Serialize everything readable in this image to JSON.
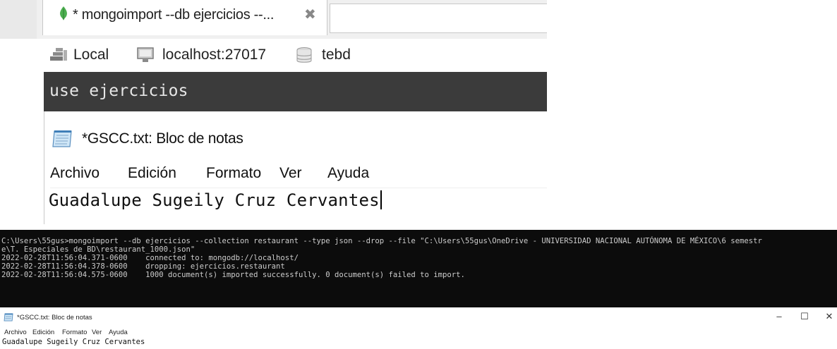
{
  "mongo_gui": {
    "tab": {
      "label": "* mongoimport --db ejercicios --...",
      "close_glyph": "✖"
    },
    "breadcrumb": {
      "local": "Local",
      "host": "localhost:27017",
      "db": "tebd"
    },
    "shell_command": "use ejercicios"
  },
  "notepad_zoom": {
    "title": "*GSCC.txt: Bloc de notas",
    "menu": [
      "Archivo",
      "Edición",
      "Formato",
      "Ver",
      "Ayuda"
    ],
    "content": "Guadalupe Sugeily Cruz Cervantes"
  },
  "console": {
    "lines": [
      "C:\\Users\\55gus>mongoimport --db ejercicios --collection restaurant --type json --drop --file \"C:\\Users\\55gus\\OneDrive - UNIVERSIDAD NACIONAL AUTÓNOMA DE MÉXICO\\6 semestr",
      "e\\T. Especiales de BD\\restaurant_1000.json\"",
      "2022-02-28T11:56:04.371-0600    connected to: mongodb://localhost/",
      "2022-02-28T11:56:04.378-0600    dropping: ejercicios.restaurant",
      "2022-02-28T11:56:04.575-0600    1000 document(s) imported successfully. 0 document(s) failed to import."
    ]
  },
  "notepad_small": {
    "title": "*GSCC.txt: Bloc de notas",
    "menu": [
      "Archivo",
      "Edición",
      "Formato",
      "Ver",
      "Ayuda"
    ],
    "content": "Guadalupe Sugeily Cruz Cervantes",
    "window_buttons": {
      "minimize": "–",
      "maximize": "☐",
      "close": "✕"
    }
  },
  "colors": {
    "shell_bg": "#3b3b3b",
    "console_bg": "#0c0c0c",
    "console_text": "#cccccc",
    "mongo_leaf": "#4caf50"
  }
}
